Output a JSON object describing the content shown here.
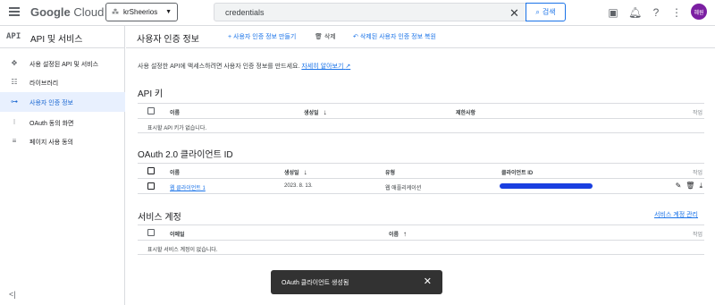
{
  "topbar": {
    "logo_google": "Google",
    "logo_cloud": "Cloud",
    "project": "krSheerios",
    "search_value": "credentials",
    "search_button": "검색",
    "avatar": "혜원"
  },
  "sidebar": {
    "api_mark": "API",
    "title": "API 및 서비스",
    "items": [
      {
        "label": "사용 설정된 API 및 서비스",
        "icon": "diamond-grid-icon"
      },
      {
        "label": "라이브러리",
        "icon": "library-icon"
      },
      {
        "label": "사용자 인증 정보",
        "icon": "key-icon"
      },
      {
        "label": "OAuth 동의 화면",
        "icon": "consent-icon"
      },
      {
        "label": "페이지 사용 동의",
        "icon": "settings-list-icon"
      }
    ],
    "active_index": 2
  },
  "header": {
    "title": "사용자 인증 정보",
    "create": "+ 사용자 인증 정보 만들기",
    "delete": "삭제",
    "restore": "삭제된 사용자 인증 정보 복원"
  },
  "description": {
    "text": "사용 설정한 API에 액세스하려면 사용자 인증 정보를 만드세요.",
    "link": "자세히 알아보기"
  },
  "api_keys": {
    "title": "API 키",
    "col_name": "이름",
    "col_created": "생성일",
    "col_restrictions": "제한사항",
    "col_actions": "작업",
    "empty": "표시할 API 키가 없습니다."
  },
  "oauth": {
    "title": "OAuth 2.0 클라이언트 ID",
    "col_name": "이름",
    "col_created": "생성일",
    "col_type": "유형",
    "col_client_id": "클라이언트 ID",
    "col_actions": "작업",
    "rows": [
      {
        "name": "웹 클라이언트 1",
        "created": "2023. 8. 13.",
        "type": "웹 애플리케이션"
      }
    ]
  },
  "service_accounts": {
    "title": "서비스 계정",
    "manage": "서비스 계정 관리",
    "col_email": "이메일",
    "col_name": "이름",
    "col_actions": "작업",
    "empty": "표시할 서비스 계정이 없습니다."
  },
  "toast": {
    "message": "OAuth 클라이언트 생성됨"
  },
  "colors": {
    "accent": "#1a73e8",
    "active_bg": "#e8f0fe",
    "avatar": "#7b1fa2",
    "toast": "#323232"
  }
}
